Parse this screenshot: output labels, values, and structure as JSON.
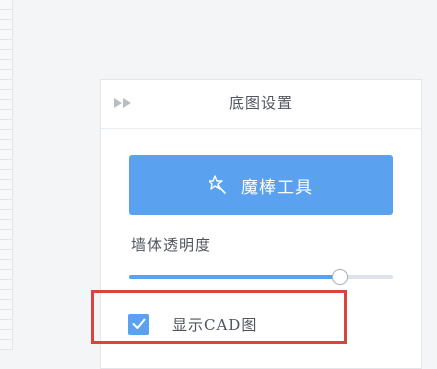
{
  "panel": {
    "title": "底图设置",
    "collapse_icon": "double-chevron-right-icon"
  },
  "magic_wand": {
    "label": "魔棒工具",
    "icon": "magic-wand-icon"
  },
  "wall_opacity": {
    "label": "墙体透明度",
    "value": 0.8
  },
  "show_cad": {
    "label": "显示CAD图",
    "checked": true
  },
  "colors": {
    "accent": "#5aa2ef",
    "highlight": "#d9443f",
    "background": "#f4f5f7",
    "panel": "#ffffff"
  }
}
